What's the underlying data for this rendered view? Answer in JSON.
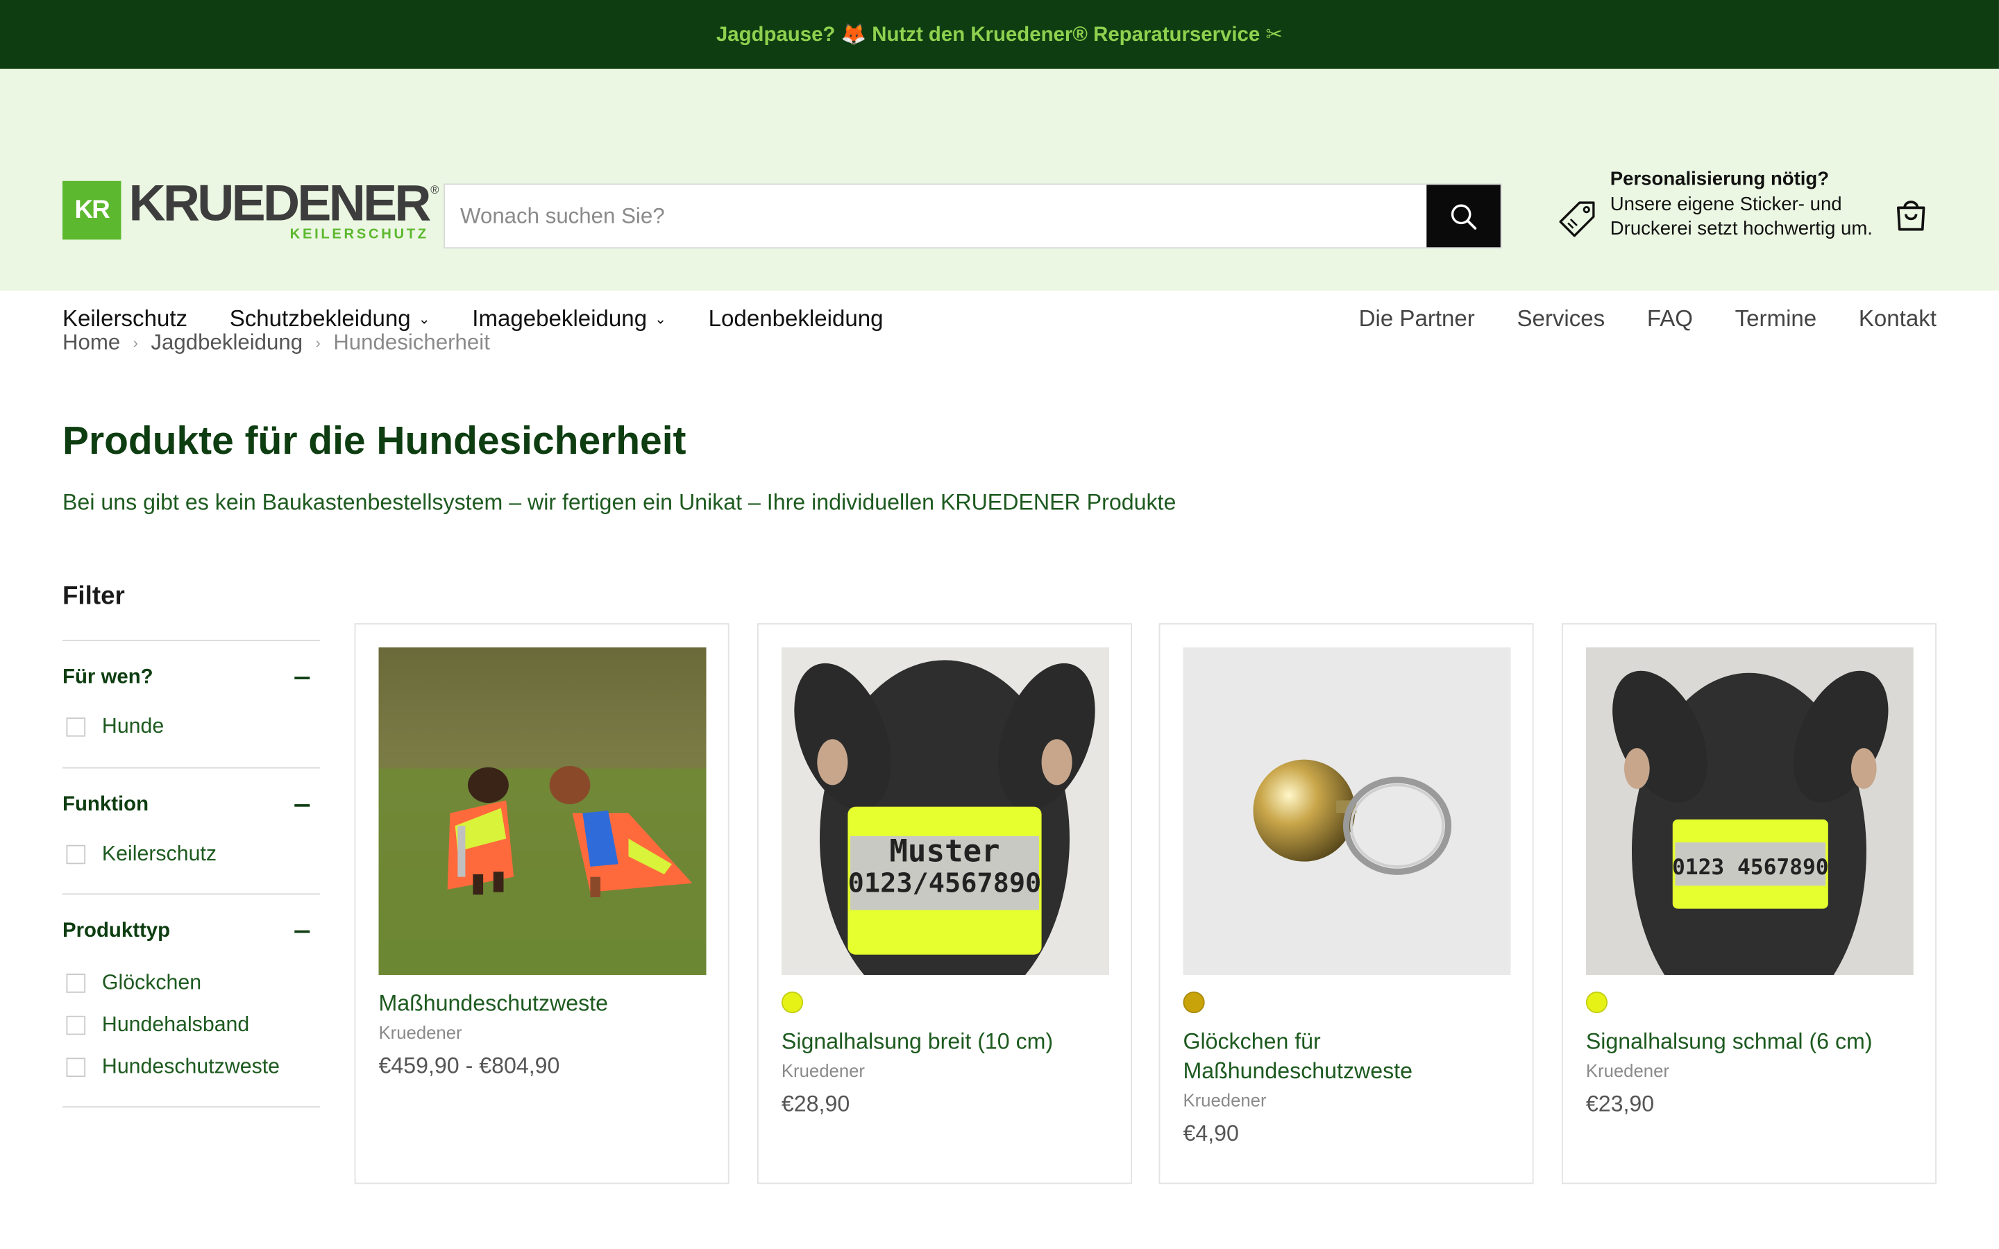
{
  "announcement": {
    "text": "Jagdpause? 🦊 Nutzt den Kruedener® Reparaturservice ✂"
  },
  "brand": {
    "mark": "KR",
    "name": "KRUEDENER",
    "tagline": "KEILERSCHUTZ",
    "reg": "®"
  },
  "search": {
    "placeholder": "Wonach suchen Sie?"
  },
  "promo": {
    "title": "Personalisierung nötig?",
    "text": "Unsere eigene Sticker- und Druckerei setzt hochwertig um."
  },
  "nav": {
    "left": [
      {
        "label": "Keilerschutz",
        "dropdown": false
      },
      {
        "label": "Schutzbekleidung",
        "dropdown": true
      },
      {
        "label": "Imagebekleidung",
        "dropdown": true
      },
      {
        "label": "Lodenbekleidung",
        "dropdown": false
      }
    ],
    "right": [
      "Die Partner",
      "Services",
      "FAQ",
      "Termine",
      "Kontakt"
    ]
  },
  "breadcrumb": [
    "Home",
    "Jagdbekleidung",
    "Hundesicherheit"
  ],
  "page": {
    "title": "Produkte für die Hundesicherheit",
    "description": "Bei uns gibt es kein Baukastenbestellsystem – wir fertigen ein Unikat – Ihre individuellen KRUEDENER Produkte"
  },
  "filter": {
    "heading": "Filter",
    "groups": [
      {
        "title": "Für wen?",
        "options": [
          "Hunde"
        ]
      },
      {
        "title": "Funktion",
        "options": [
          "Keilerschutz"
        ]
      },
      {
        "title": "Produkttyp",
        "options": [
          "Glöckchen",
          "Hundehalsband",
          "Hundeschutzweste"
        ]
      }
    ]
  },
  "products": [
    {
      "title": "Maßhundeschutzweste",
      "vendor": "Kruedener",
      "price": "€459,90 - €804,90",
      "swatch": null
    },
    {
      "title": "Signalhalsung breit (10 cm)",
      "vendor": "Kruedener",
      "price": "€28,90",
      "swatch": "#e6f216",
      "band_text": [
        "Muster",
        "0123/4567890"
      ]
    },
    {
      "title": "Glöckchen für Maßhundeschutzweste",
      "vendor": "Kruedener",
      "price": "€4,90",
      "swatch": "#c9a30a"
    },
    {
      "title": "Signalhalsung schmal (6 cm)",
      "vendor": "Kruedener",
      "price": "€23,90",
      "swatch": "#e6f216",
      "band_text": [
        "0123 4567890"
      ]
    }
  ],
  "colors": {
    "announce_bg": "#0d3d10",
    "announce_text": "#8fd14f",
    "header_bg": "#ebf7e2",
    "brand_green": "#5cb82e",
    "title_green": "#0d3d10"
  },
  "icons": [
    "search-icon",
    "tag-icon",
    "shopping-bag-icon",
    "chevron-down-icon",
    "minus-icon",
    "chevron-right-icon"
  ]
}
